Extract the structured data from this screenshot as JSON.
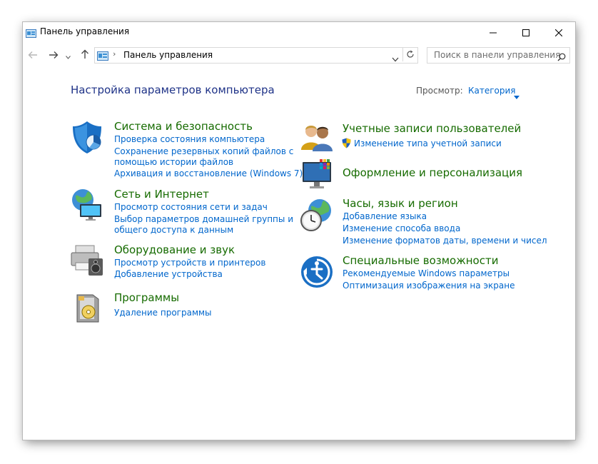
{
  "window": {
    "title": "Панель управления"
  },
  "toolbar": {
    "breadcrumb": "Панель управления",
    "search_placeholder": "Поиск в панели управления"
  },
  "main": {
    "heading": "Настройка параметров компьютера",
    "view_label": "Просмотр:",
    "view_value": "Категория"
  },
  "left_column": [
    {
      "title": "Система и безопасность",
      "links": [
        "Проверка состояния компьютера",
        "Сохранение резервных копий файлов с",
        "помощью истории файлов",
        "Архивация и восстановление (Windows 7)"
      ]
    },
    {
      "title": "Сеть и Интернет",
      "links": [
        "Просмотр состояния сети и задач",
        "Выбор параметров домашней группы и",
        "общего доступа к данным"
      ]
    },
    {
      "title": "Оборудование и звук",
      "links": [
        "Просмотр устройств и принтеров",
        "Добавление устройства"
      ]
    },
    {
      "title": "Программы",
      "links": [
        "Удаление программы"
      ]
    }
  ],
  "right_column": [
    {
      "title": "Учетные записи пользователей",
      "links": [
        "Изменение типа учетной записи"
      ]
    },
    {
      "title": "Оформление и персонализация",
      "links": []
    },
    {
      "title": "Часы, язык и регион",
      "links": [
        "Добавление языка",
        "Изменение способа ввода",
        "Изменение форматов даты, времени и чисел"
      ]
    },
    {
      "title": "Специальные возможности",
      "links": [
        "Рекомендуемые Windows параметры",
        "Оптимизация изображения на экране"
      ]
    }
  ],
  "icons": {
    "title": "control-panel-icon",
    "minimize": "minimize-icon",
    "maximize": "maximize-icon",
    "close": "close-icon",
    "back": "back-arrow-icon",
    "forward": "forward-arrow-icon",
    "up": "up-arrow-icon",
    "refresh": "refresh-icon",
    "search": "search-icon",
    "uac": "uac-shield-icon"
  },
  "colors": {
    "heading": "#1e3287",
    "category_title": "#166b00",
    "link": "#0066cc"
  }
}
